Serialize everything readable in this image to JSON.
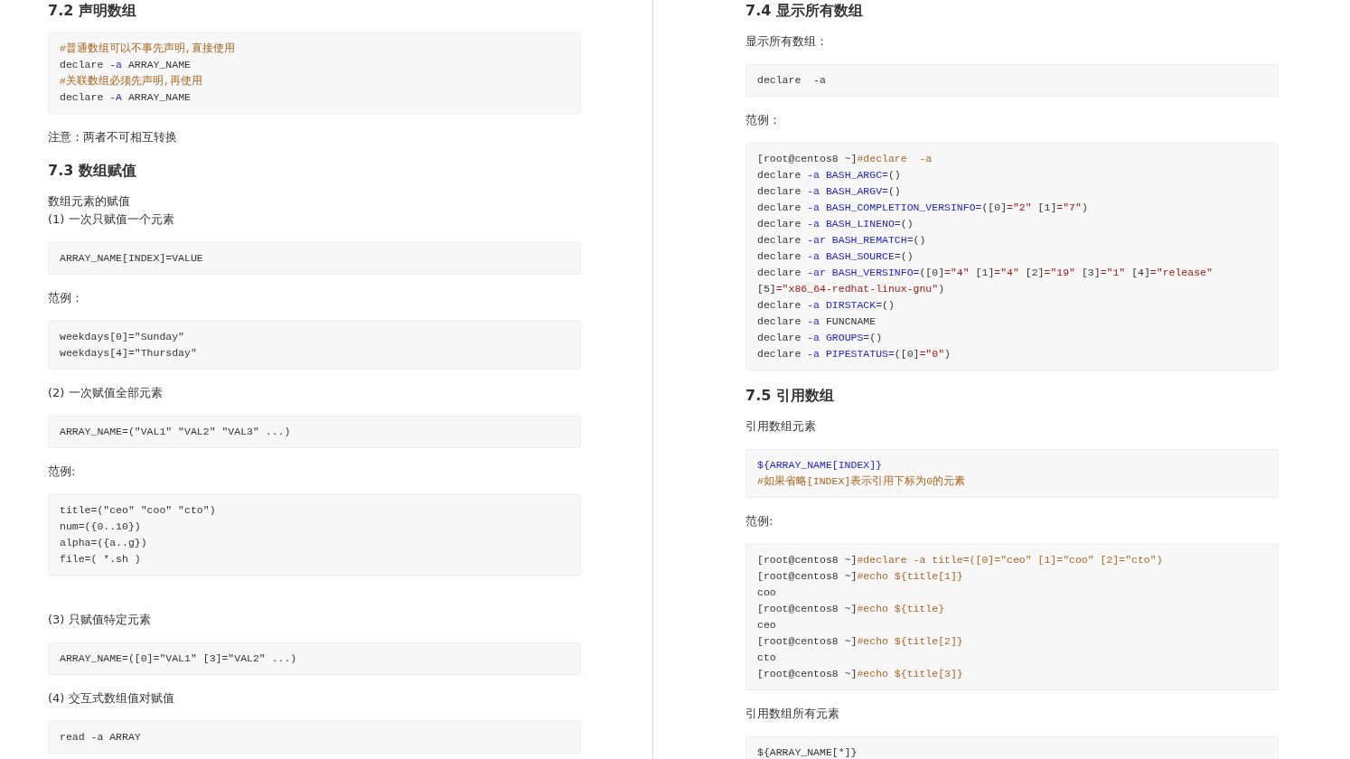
{
  "pages": [
    {
      "blocks": [
        {
          "kind": "heading",
          "text": "7.2 声明数组"
        },
        {
          "kind": "code",
          "lines": [
            [
              {
                "text": "#普通数组可以不事先声明,直接使用",
                "kind": "comment"
              }
            ],
            [
              {
                "text": "declare ",
                "kind": "plain"
              },
              {
                "text": "-a",
                "kind": "keyword"
              },
              {
                "text": " ARRAY_NAME",
                "kind": "plain"
              }
            ],
            [
              {
                "text": "#关联数组必须先声明,再使用",
                "kind": "comment"
              }
            ],
            [
              {
                "text": "declare ",
                "kind": "plain"
              },
              {
                "text": "-A",
                "kind": "keyword"
              },
              {
                "text": " ARRAY_NAME",
                "kind": "plain"
              }
            ]
          ]
        },
        {
          "kind": "para",
          "lines": [
            "注意：两者不可相互转换"
          ]
        },
        {
          "kind": "heading",
          "text": "7.3 数组赋值"
        },
        {
          "kind": "para",
          "lines": [
            "数组元素的赋值",
            "(1) 一次只赋值一个元素"
          ]
        },
        {
          "kind": "code",
          "lines": [
            [
              {
                "text": "ARRAY_NAME[INDEX]=VALUE",
                "kind": "plain"
              }
            ]
          ]
        },
        {
          "kind": "para",
          "lines": [
            "范例："
          ]
        },
        {
          "kind": "code",
          "lines": [
            [
              {
                "text": "weekdays[0]=\"Sunday\"",
                "kind": "plain"
              }
            ],
            [
              {
                "text": "weekdays[4]=\"Thursday\"",
                "kind": "plain"
              }
            ]
          ]
        },
        {
          "kind": "para",
          "lines": [
            "(2) 一次赋值全部元素"
          ]
        },
        {
          "kind": "code",
          "lines": [
            [
              {
                "text": "ARRAY_NAME=(\"VAL1\" \"VAL2\" \"VAL3\" ...)",
                "kind": "plain"
              }
            ]
          ]
        },
        {
          "kind": "para",
          "lines": [
            "范例:"
          ]
        },
        {
          "kind": "code",
          "lines": [
            [
              {
                "text": "title=(\"ceo\" \"coo\" \"cto\")",
                "kind": "plain"
              }
            ],
            [
              {
                "text": "num=({0..10})",
                "kind": "plain"
              }
            ],
            [
              {
                "text": "alpha=({a..g})",
                "kind": "plain"
              }
            ],
            [
              {
                "text": "file=( *.sh )",
                "kind": "plain"
              }
            ]
          ]
        },
        {
          "kind": "para",
          "lines": [
            "(3) 只赋值特定元素"
          ]
        },
        {
          "kind": "code",
          "lines": [
            [
              {
                "text": "ARRAY_NAME=([0]=\"VAL1\" [3]=\"VAL2\" ...)",
                "kind": "plain"
              }
            ]
          ]
        },
        {
          "kind": "para",
          "lines": [
            "(4) 交互式数组值对赋值"
          ]
        },
        {
          "kind": "code",
          "lines": [
            [
              {
                "text": "read -a ARRAY",
                "kind": "plain"
              }
            ]
          ]
        }
      ]
    },
    {
      "blocks": [
        {
          "kind": "heading",
          "text": "7.4 显示所有数组"
        },
        {
          "kind": "para",
          "lines": [
            "显示所有数组："
          ]
        },
        {
          "kind": "code",
          "lines": [
            [
              {
                "text": "declare  -a",
                "kind": "plain"
              }
            ]
          ]
        },
        {
          "kind": "para",
          "lines": [
            "范例："
          ]
        },
        {
          "kind": "code",
          "lines": [
            [
              {
                "text": "[root@centos8 ~]",
                "kind": "plain"
              },
              {
                "text": "#declare  -a",
                "kind": "comment"
              }
            ],
            [
              {
                "text": "declare ",
                "kind": "plain"
              },
              {
                "text": "-a BASH_ARGC=",
                "kind": "keyword"
              },
              {
                "text": "()",
                "kind": "plain"
              }
            ],
            [
              {
                "text": "declare ",
                "kind": "plain"
              },
              {
                "text": "-a BASH_ARGV=",
                "kind": "keyword"
              },
              {
                "text": "()",
                "kind": "plain"
              }
            ],
            [
              {
                "text": "declare ",
                "kind": "plain"
              },
              {
                "text": "-a BASH_COMPLETION_VERSINFO=",
                "kind": "keyword"
              },
              {
                "text": "([0]",
                "kind": "plain"
              },
              {
                "text": "=\"2\"",
                "kind": "string"
              },
              {
                "text": " [1]",
                "kind": "plain"
              },
              {
                "text": "=\"7\"",
                "kind": "string"
              },
              {
                "text": ")",
                "kind": "plain"
              }
            ],
            [
              {
                "text": "declare ",
                "kind": "plain"
              },
              {
                "text": "-a BASH_LINENO=",
                "kind": "keyword"
              },
              {
                "text": "()",
                "kind": "plain"
              }
            ],
            [
              {
                "text": "declare ",
                "kind": "plain"
              },
              {
                "text": "-ar BASH_REMATCH=",
                "kind": "keyword"
              },
              {
                "text": "()",
                "kind": "plain"
              }
            ],
            [
              {
                "text": "declare ",
                "kind": "plain"
              },
              {
                "text": "-a BASH_SOURCE=",
                "kind": "keyword"
              },
              {
                "text": "()",
                "kind": "plain"
              }
            ],
            [
              {
                "text": "declare ",
                "kind": "plain"
              },
              {
                "text": "-ar BASH_VERSINFO=",
                "kind": "keyword"
              },
              {
                "text": "([0]",
                "kind": "plain"
              },
              {
                "text": "=\"4\"",
                "kind": "string"
              },
              {
                "text": " [1]",
                "kind": "plain"
              },
              {
                "text": "=\"4\"",
                "kind": "string"
              },
              {
                "text": " [2]",
                "kind": "plain"
              },
              {
                "text": "=\"19\"",
                "kind": "string"
              },
              {
                "text": " [3]",
                "kind": "plain"
              },
              {
                "text": "=\"1\"",
                "kind": "string"
              },
              {
                "text": " [4]",
                "kind": "plain"
              },
              {
                "text": "=\"release\"",
                "kind": "string"
              }
            ],
            [
              {
                "text": "[5]",
                "kind": "plain"
              },
              {
                "text": "=\"x86_64-redhat-linux-gnu\"",
                "kind": "string"
              },
              {
                "text": ")",
                "kind": "plain"
              }
            ],
            [
              {
                "text": "declare ",
                "kind": "plain"
              },
              {
                "text": "-a DIRSTACK=",
                "kind": "keyword"
              },
              {
                "text": "()",
                "kind": "plain"
              }
            ],
            [
              {
                "text": "declare ",
                "kind": "plain"
              },
              {
                "text": "-a",
                "kind": "keyword"
              },
              {
                "text": " FUNCNAME",
                "kind": "plain"
              }
            ],
            [
              {
                "text": "declare ",
                "kind": "plain"
              },
              {
                "text": "-a GROUPS=",
                "kind": "keyword"
              },
              {
                "text": "()",
                "kind": "plain"
              }
            ],
            [
              {
                "text": "declare ",
                "kind": "plain"
              },
              {
                "text": "-a PIPESTATUS=",
                "kind": "keyword"
              },
              {
                "text": "([0]",
                "kind": "plain"
              },
              {
                "text": "=\"0\"",
                "kind": "string"
              },
              {
                "text": ")",
                "kind": "plain"
              }
            ]
          ]
        },
        {
          "kind": "heading",
          "text": "7.5 引用数组"
        },
        {
          "kind": "para",
          "lines": [
            "引用数组元素"
          ]
        },
        {
          "kind": "code",
          "lines": [
            [
              {
                "text": "${ARRAY_NAME[INDEX]}",
                "kind": "keyword"
              }
            ],
            [
              {
                "text": "#如果省略[INDEX]表示引用下标为0的元素",
                "kind": "comment"
              }
            ]
          ]
        },
        {
          "kind": "para",
          "lines": [
            "范例:"
          ]
        },
        {
          "kind": "code",
          "lines": [
            [
              {
                "text": "[root@centos8 ~]",
                "kind": "plain"
              },
              {
                "text": "#declare -a title=([0]=\"ceo\" [1]=\"coo\" [2]=\"cto\")",
                "kind": "comment"
              }
            ],
            [
              {
                "text": "[root@centos8 ~]",
                "kind": "plain"
              },
              {
                "text": "#echo ${title[1]}",
                "kind": "comment"
              }
            ],
            [
              {
                "text": "coo",
                "kind": "plain"
              }
            ],
            [
              {
                "text": "[root@centos8 ~]",
                "kind": "plain"
              },
              {
                "text": "#echo ${title}",
                "kind": "comment"
              }
            ],
            [
              {
                "text": "ceo",
                "kind": "plain"
              }
            ],
            [
              {
                "text": "[root@centos8 ~]",
                "kind": "plain"
              },
              {
                "text": "#echo ${title[2]}",
                "kind": "comment"
              }
            ],
            [
              {
                "text": "cto",
                "kind": "plain"
              }
            ],
            [
              {
                "text": "[root@centos8 ~]",
                "kind": "plain"
              },
              {
                "text": "#echo ${title[3]}",
                "kind": "comment"
              }
            ]
          ]
        },
        {
          "kind": "para",
          "lines": [
            "引用数组所有元素"
          ]
        },
        {
          "kind": "code",
          "lines": [
            [
              {
                "text": "${ARRAY_NAME[*]}",
                "kind": "plain"
              }
            ]
          ]
        }
      ]
    }
  ]
}
